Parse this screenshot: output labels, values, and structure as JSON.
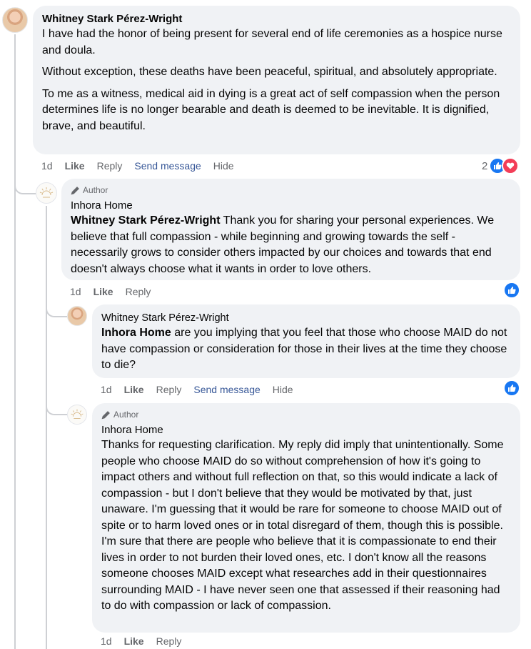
{
  "comment1": {
    "author": "Whitney Stark Pérez-Wright",
    "paragraphs": [
      "I have had the honor of being present for several end of life ceremonies as a hospice nurse and doula.",
      "Without exception, these deaths have been peaceful, spiritual, and absolutely appropriate.",
      "To me as a witness, medical aid in dying is a great act of self compassion when the person determines life is no longer bearable and death is deemed to be inevitable. It is dignified, brave, and beautiful."
    ],
    "actions": {
      "time": "1d",
      "like": "Like",
      "reply": "Reply",
      "send": "Send message",
      "hide": "Hide"
    },
    "reaction_count": "2",
    "reactions": [
      "like-icon",
      "love-icon"
    ]
  },
  "reply1": {
    "badge": "Author",
    "author": "Inhora Home",
    "mention": "Whitney Stark Pérez-Wright",
    "text": " Thank you for sharing your personal experiences. We believe that full compassion - while beginning and growing towards the self - necessarily grows to consider others impacted by our choices and towards that end doesn't always choose what it wants in order to love others.",
    "actions": {
      "time": "1d",
      "like": "Like",
      "reply": "Reply"
    },
    "reactions": [
      "like-icon"
    ]
  },
  "reply2": {
    "author": "Whitney Stark Pérez-Wright",
    "mention": "Inhora Home",
    "text": " are you implying that you feel that those who choose MAID do not have compassion or consideration for those in their lives at the time they choose to die?",
    "actions": {
      "time": "1d",
      "like": "Like",
      "reply": "Reply",
      "send": "Send message",
      "hide": "Hide"
    },
    "reactions": [
      "like-icon"
    ]
  },
  "reply3": {
    "badge": "Author",
    "author": "Inhora Home",
    "text": "Thanks for requesting clarification. My reply did imply that unintentionally. Some people who choose MAID do so without comprehension of how it's going to impact others and without full reflection on that, so this would indicate a lack of compassion - but I don't believe that they would be motivated by that, just unaware. I'm guessing that it would be rare for someone to choose MAID out of spite or to harm loved ones or in total disregard of them, though this is possible. I'm sure that there are people who believe that it is compassionate to end their lives in order to not burden their loved ones, etc. I don't know all the reasons someone chooses MAID except what researches add in their questionnaires surrounding MAID - I have never seen one that assessed if their reasoning had to do with compassion or lack of compassion.",
    "actions": {
      "time": "1d",
      "like": "Like",
      "reply": "Reply"
    }
  },
  "colors": {
    "like_blue": "#1877f2",
    "heart_red": "#f33e58",
    "bubble": "#f0f2f5",
    "link_blue": "#385898"
  }
}
